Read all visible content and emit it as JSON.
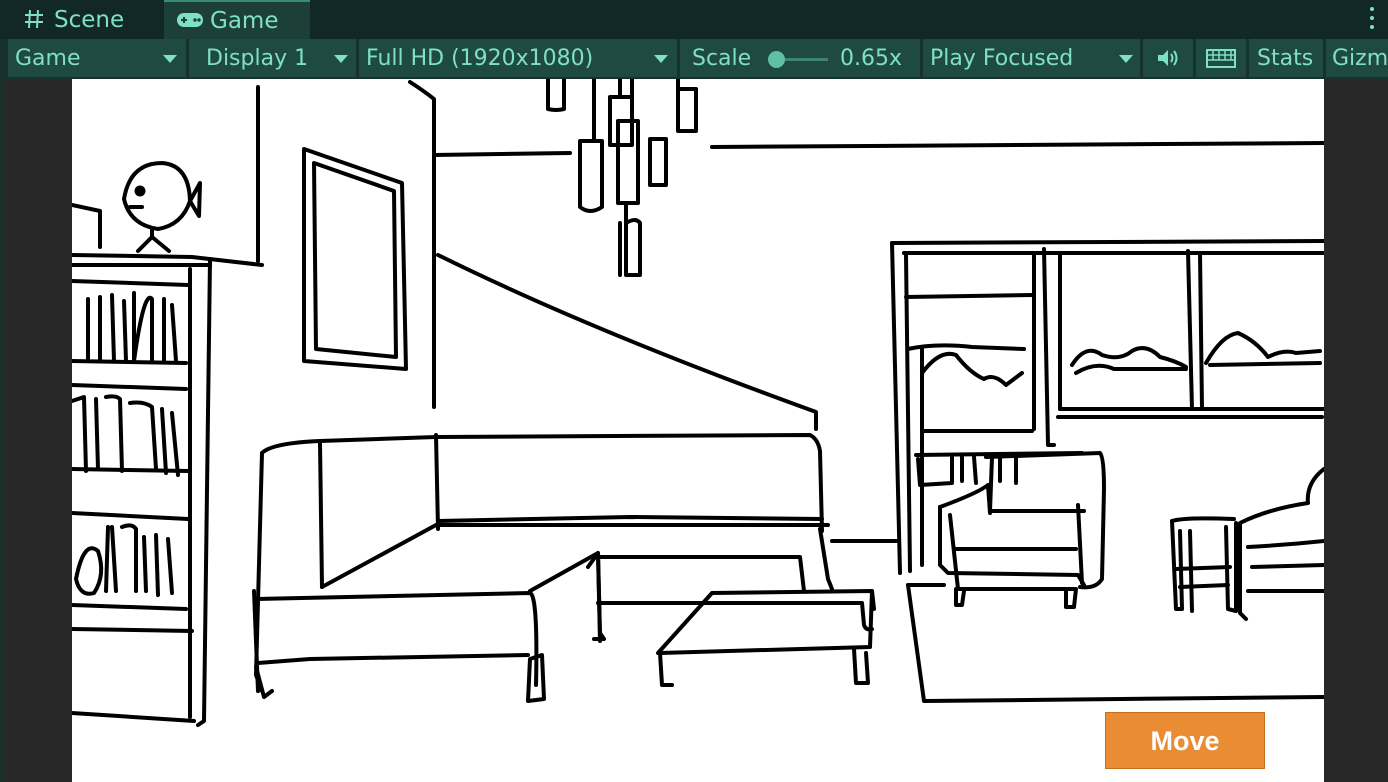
{
  "tabs": [
    {
      "label": "Scene",
      "icon": "hash-icon"
    },
    {
      "label": "Game",
      "icon": "gamepad-icon"
    }
  ],
  "toolbar": {
    "view_mode": "Game",
    "display": "Display 1",
    "resolution": "Full HD (1920x1080)",
    "scale_label": "Scale",
    "scale_value": "0.65x",
    "play_mode": "Play Focused",
    "stats_label": "Stats",
    "gizmos_label": "Gizm",
    "audio_icon": "speaker-icon",
    "keyboard_icon": "keyboard-icon"
  },
  "game": {
    "move_button": "Move"
  },
  "colors": {
    "accent_text": "#7fe0c6",
    "toolbar_bg": "#1f4a41",
    "tabbar_bg": "#122826",
    "move_button": "#e88d34"
  }
}
